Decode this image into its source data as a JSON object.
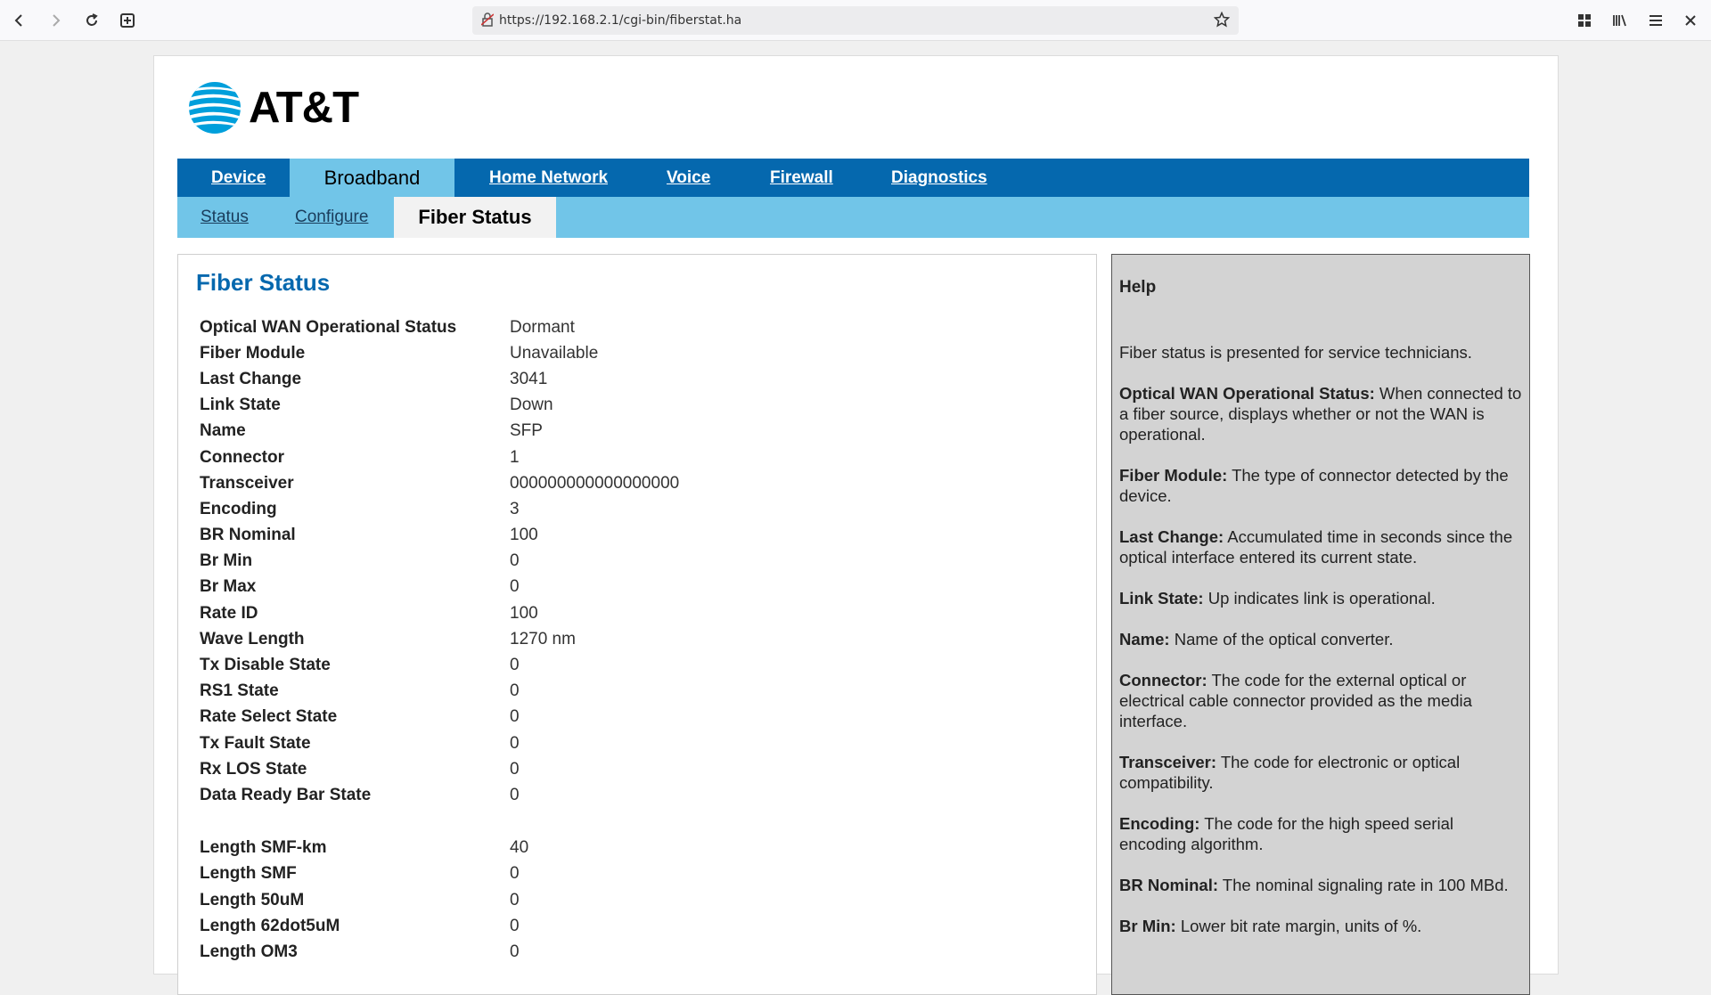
{
  "browser": {
    "url": "https://192.168.2.1/cgi-bin/fiberstat.ha"
  },
  "brand": {
    "logo_text": "AT&T"
  },
  "primary_nav": [
    {
      "label": "Device",
      "active": false
    },
    {
      "label": "Broadband",
      "active": true
    },
    {
      "label": "Home Network",
      "active": false
    },
    {
      "label": "Voice",
      "active": false
    },
    {
      "label": "Firewall",
      "active": false
    },
    {
      "label": "Diagnostics",
      "active": false
    }
  ],
  "secondary_nav": [
    {
      "label": "Status",
      "active": false
    },
    {
      "label": "Configure",
      "active": false
    },
    {
      "label": "Fiber Status",
      "active": true
    }
  ],
  "content": {
    "title": "Fiber Status",
    "rows": [
      {
        "label": "Optical WAN Operational Status",
        "value": "Dormant"
      },
      {
        "label": "Fiber Module",
        "value": "Unavailable"
      },
      {
        "label": "Last Change",
        "value": "3041"
      },
      {
        "label": "Link State",
        "value": "Down"
      },
      {
        "label": "Name",
        "value": "SFP"
      },
      {
        "label": "Connector",
        "value": "1"
      },
      {
        "label": "Transceiver",
        "value": "000000000000000000"
      },
      {
        "label": "Encoding",
        "value": "3"
      },
      {
        "label": "BR Nominal",
        "value": "100"
      },
      {
        "label": "Br Min",
        "value": "0"
      },
      {
        "label": "Br Max",
        "value": "0"
      },
      {
        "label": "Rate ID",
        "value": "100"
      },
      {
        "label": "Wave Length",
        "value": "1270 nm"
      },
      {
        "label": "Tx Disable State",
        "value": "0"
      },
      {
        "label": "RS1 State",
        "value": "0"
      },
      {
        "label": "Rate Select State",
        "value": "0"
      },
      {
        "label": "Tx Fault State",
        "value": "0"
      },
      {
        "label": "Rx LOS State",
        "value": "0"
      },
      {
        "label": "Data Ready Bar State",
        "value": "0"
      }
    ],
    "rows2": [
      {
        "label": "Length SMF-km",
        "value": "40"
      },
      {
        "label": "Length SMF",
        "value": "0"
      },
      {
        "label": "Length 50uM",
        "value": "0"
      },
      {
        "label": "Length 62dot5uM",
        "value": "0"
      },
      {
        "label": "Length OM3",
        "value": "0"
      }
    ]
  },
  "help": {
    "title": "Help",
    "intro": "Fiber status is presented for service technicians.",
    "items": [
      {
        "term": "Optical WAN Operational Status:",
        "text": " When connected to a fiber source, displays whether or not the WAN is operational."
      },
      {
        "term": "Fiber Module:",
        "text": " The type of connector detected by the device."
      },
      {
        "term": "Last Change:",
        "text": " Accumulated time in seconds since the optical interface entered its current state."
      },
      {
        "term": "Link State:",
        "text": " Up indicates link is operational."
      },
      {
        "term": "Name:",
        "text": " Name of the optical converter."
      },
      {
        "term": "Connector:",
        "text": " The code for the external optical or electrical cable connector provided as the media interface."
      },
      {
        "term": "Transceiver:",
        "text": " The code for electronic or optical compatibility."
      },
      {
        "term": "Encoding:",
        "text": " The code for the high speed serial encoding algorithm."
      },
      {
        "term": "BR Nominal:",
        "text": " The nominal signaling rate in 100 MBd."
      },
      {
        "term": "Br Min:",
        "text": " Lower bit rate margin, units of %."
      }
    ]
  },
  "colors": {
    "primary_nav_bg": "#0568ae",
    "secondary_nav_bg": "#71c5e8",
    "title_color": "#0568ae",
    "help_bg": "#d3d3d3"
  }
}
